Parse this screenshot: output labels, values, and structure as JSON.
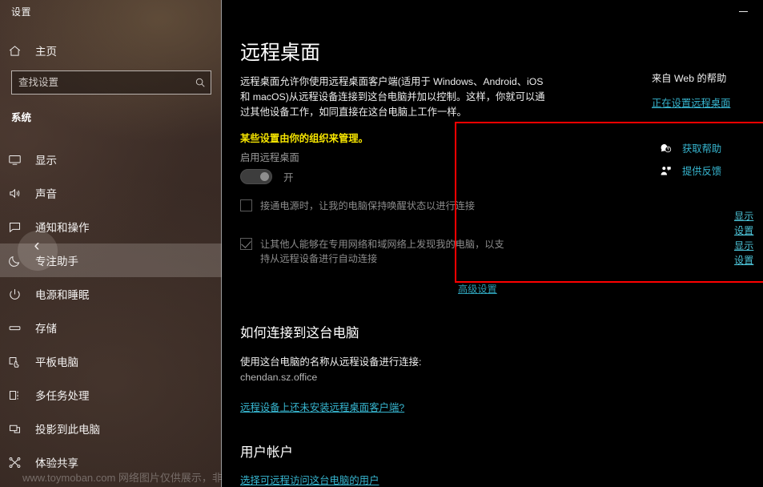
{
  "window": {
    "settings_title": "设置",
    "minimize_label": "—"
  },
  "sidebar": {
    "home_label": "主页",
    "home_icon": "home-icon",
    "search": {
      "placeholder": "查找设置",
      "value": "",
      "icon": "search-icon"
    },
    "section_heading": "系统",
    "back_icon": "chevron-left-icon",
    "items": [
      {
        "label": "显示",
        "icon": "monitor-icon",
        "selected": false
      },
      {
        "label": "声音",
        "icon": "speaker-icon",
        "selected": false
      },
      {
        "label": "通知和操作",
        "icon": "notification-icon",
        "selected": false
      },
      {
        "label": "专注助手",
        "icon": "moon-icon",
        "selected": true
      },
      {
        "label": "电源和睡眠",
        "icon": "power-icon",
        "selected": false
      },
      {
        "label": "存储",
        "icon": "storage-icon",
        "selected": false
      },
      {
        "label": "平板电脑",
        "icon": "tablet-icon",
        "selected": false
      },
      {
        "label": "多任务处理",
        "icon": "multitask-icon",
        "selected": false
      },
      {
        "label": "投影到此电脑",
        "icon": "project-icon",
        "selected": false
      },
      {
        "label": "体验共享",
        "icon": "share-experience-icon",
        "selected": false
      }
    ],
    "watermark": "www.toymoban.com 网络图片仅供展示，非商"
  },
  "main": {
    "page_title": "远程桌面",
    "description": "远程桌面允许你使用远程桌面客户端(适用于 Windows、Android、iOS 和 macOS)从远程设备连接到这台电脑并加以控制。这样，你就可以通过其他设备工作，如同直接在这台电脑上工作一样。",
    "org_warning": "某些设置由你的组织来管理。",
    "enable_label": "启用远程桌面",
    "toggle": {
      "state_label": "开",
      "checked": true,
      "disabled": true
    },
    "checkbox_1": {
      "label": "接通电源时，让我的电脑保持唤醒状态以进行连接",
      "checked": false,
      "disabled": true,
      "show_settings_label": "显示设置"
    },
    "checkbox_2": {
      "label": "让其他人能够在专用网络和域网络上发现我的电脑，以支持从远程设备进行自动连接",
      "checked": true,
      "disabled": true,
      "show_settings_label": "显示设置"
    },
    "advanced_settings_label": "高级设置",
    "connect_heading": "如何连接到这台电脑",
    "connect_desc": "使用这台电脑的名称从远程设备进行连接:",
    "pc_name": "chendan.sz.office",
    "client_link": "远程设备上还未安装远程桌面客户端?",
    "account_heading": "用户帐户",
    "account_link": "选择可远程访问这台电脑的用户",
    "highlight_color": "#fe0000",
    "link_color": "#37b6d0",
    "warning_color": "#f7e600"
  },
  "help_panel": {
    "title": "来自 Web 的帮助",
    "setup_link": "正在设置远程桌面",
    "get_help": {
      "label": "获取帮助",
      "icon": "help-question-icon"
    },
    "feedback": {
      "label": "提供反馈",
      "icon": "feedback-person-icon"
    }
  }
}
